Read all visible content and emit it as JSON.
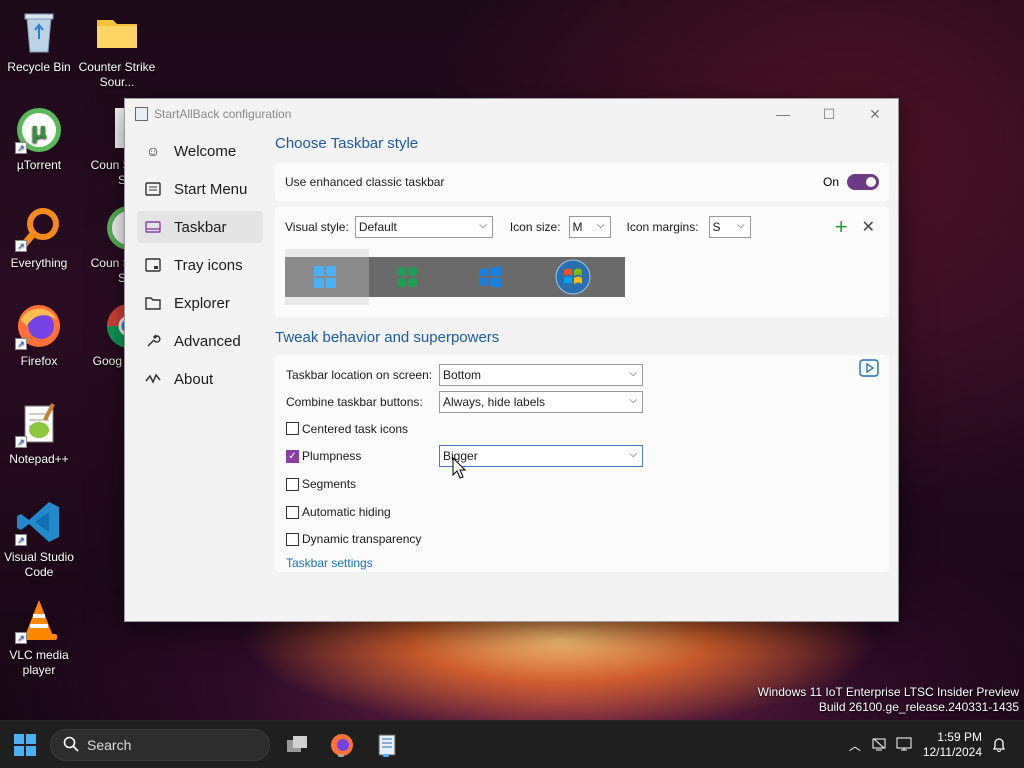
{
  "desktop": {
    "icons": [
      {
        "label": "Recycle Bin"
      },
      {
        "label": "Counter Strike Sour..."
      },
      {
        "label": "µTorrent"
      },
      {
        "label": "Coun Strike S"
      },
      {
        "label": "Everything"
      },
      {
        "label": "Coun Strike S"
      },
      {
        "label": "Firefox"
      },
      {
        "label": "Goog Chro"
      },
      {
        "label": "Notepad++"
      },
      {
        "label": "Visual Studio Code"
      },
      {
        "label": "VLC media player"
      }
    ],
    "watermark_line1": "Windows 11 IoT Enterprise LTSC Insider Preview",
    "watermark_line2": "Build 26100.ge_release.240331-1435"
  },
  "window": {
    "title": "StartAllBack configuration",
    "controls": {
      "minimize": "—",
      "maximize": "☐",
      "close": "✕"
    }
  },
  "sidebar": {
    "items": [
      {
        "label": "Welcome",
        "icon": "☺"
      },
      {
        "label": "Start Menu",
        "icon": "▭"
      },
      {
        "label": "Taskbar",
        "icon": "▭"
      },
      {
        "label": "Tray icons",
        "icon": "▭"
      },
      {
        "label": "Explorer",
        "icon": "▭"
      },
      {
        "label": "Advanced",
        "icon": "🔧"
      },
      {
        "label": "About",
        "icon": "〜"
      }
    ]
  },
  "taskbar_style": {
    "section_title": "Choose Taskbar style",
    "enhanced_label": "Use enhanced classic taskbar",
    "enhanced_state": "On",
    "visual_style_label": "Visual style:",
    "visual_style_value": "Default",
    "icon_size_label": "Icon size:",
    "icon_size_value": "M",
    "icon_margins_label": "Icon margins:",
    "icon_margins_value": "S",
    "add_icon": "+",
    "remove_icon": "✕"
  },
  "tweaks": {
    "section_title": "Tweak behavior and superpowers",
    "location_label": "Taskbar location on screen:",
    "location_value": "Bottom",
    "combine_label": "Combine taskbar buttons:",
    "combine_value": "Always, hide labels",
    "centered_label": "Centered task icons",
    "plumpness_label": "Plumpness",
    "plumpness_value": "Bigger",
    "segments_label": "Segments",
    "autohide_label": "Automatic hiding",
    "dyntrans_label": "Dynamic transparency",
    "settings_link": "Taskbar settings",
    "checkboxes": {
      "centered": false,
      "plumpness": true,
      "segments": false,
      "autohide": false,
      "dyntrans": false
    }
  },
  "taskbar": {
    "search_placeholder": "Search",
    "time": "1:59 PM",
    "date": "12/11/2024"
  },
  "colors": {
    "accent": "#6d3b84",
    "section_title": "#1e5a9c",
    "link": "#1e6fb8",
    "win_blue": "#4cb0f5"
  }
}
